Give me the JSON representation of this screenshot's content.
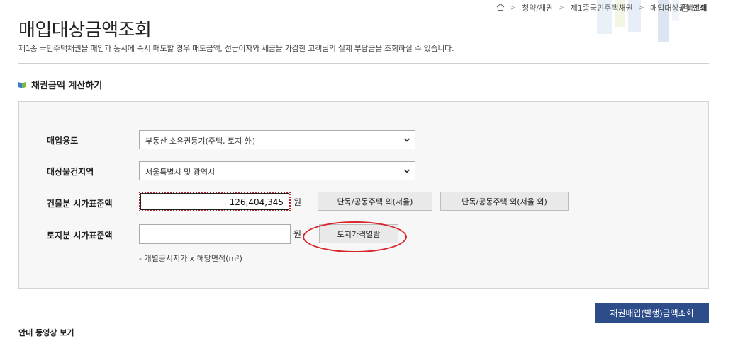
{
  "breadcrumb": {
    "items": [
      "청약/채권",
      "제1종국민주택채권",
      "매입대상금액조회"
    ],
    "print_label": "인쇄"
  },
  "page": {
    "title": "매입대상금액조회",
    "description": "제1종 국민주택채권을 매입과 동시에 즉시 매도할 경우 매도금액, 선급이자와 세금을 가감한 고객님의 실제 부담금을 조회하실 수 있습니다."
  },
  "section": {
    "title": "채권금액 계산하기"
  },
  "form": {
    "purpose": {
      "label": "매입용도",
      "selected": "부동산 소유권등기(주택, 토지 外)"
    },
    "region": {
      "label": "대상물건지역",
      "selected": "서울특별시 및 광역시"
    },
    "building_price": {
      "label": "건물분 시가표준액",
      "value": "126,404,345",
      "unit": "원",
      "btn_seoul": "단독/공동주택 외(서울)",
      "btn_other": "단독/공동주택 외(서울 외)"
    },
    "land_price": {
      "label": "토지분 시가표준액",
      "value": "",
      "unit": "원",
      "btn_view": "토지가격열람",
      "note": "- 개별공시지가 x 해당면적(m²)"
    }
  },
  "actions": {
    "submit": "채권매입(발행)금액조회"
  },
  "footer": {
    "video_label": "안내 동영상 보기"
  },
  "colors": {
    "primary": "#2c4d8a",
    "highlight": "#d7262b",
    "focus": "#b8242a"
  }
}
